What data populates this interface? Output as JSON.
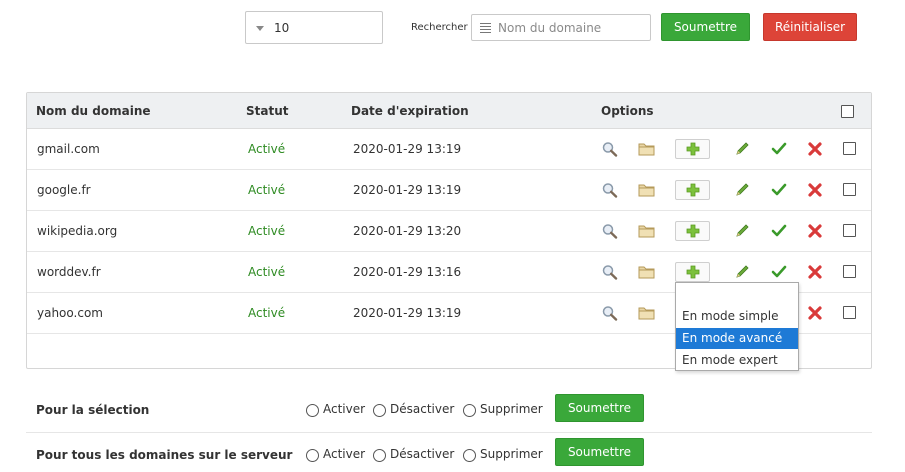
{
  "toolbar": {
    "per_page_value": "10",
    "search_label": "Rechercher",
    "search_placeholder": "Nom du domaine",
    "submit_label": "Soumettre",
    "reset_label": "Réinitialiser"
  },
  "table": {
    "headers": {
      "domain": "Nom du domaine",
      "status": "Statut",
      "expiration": "Date d'expiration",
      "options": "Options"
    },
    "rows": [
      {
        "domain": "gmail.com",
        "status": "Activé",
        "expiration": "2020-01-29 13:19"
      },
      {
        "domain": "google.fr",
        "status": "Activé",
        "expiration": "2020-01-29 13:19"
      },
      {
        "domain": "wikipedia.org",
        "status": "Activé",
        "expiration": "2020-01-29 13:20"
      },
      {
        "domain": "worddev.fr",
        "status": "Activé",
        "expiration": "2020-01-29 13:16"
      },
      {
        "domain": "yahoo.com",
        "status": "Activé",
        "expiration": "2020-01-29 13:19"
      }
    ]
  },
  "dropdown": {
    "items": [
      "En mode simple",
      "En mode avancé",
      "En mode expert"
    ],
    "highlighted": "En mode avancé"
  },
  "bulk": {
    "selection_label": "Pour la sélection",
    "all_label": "Pour tous les domaines sur le serveur",
    "options": [
      "Activer",
      "Désactiver",
      "Supprimer"
    ],
    "submit_label": "Soumettre"
  },
  "colors": {
    "status_active": "#2e8b22",
    "submit": "#3aa83a",
    "reset": "#dd4438",
    "dropdown_highlight": "#1e7ad6"
  }
}
